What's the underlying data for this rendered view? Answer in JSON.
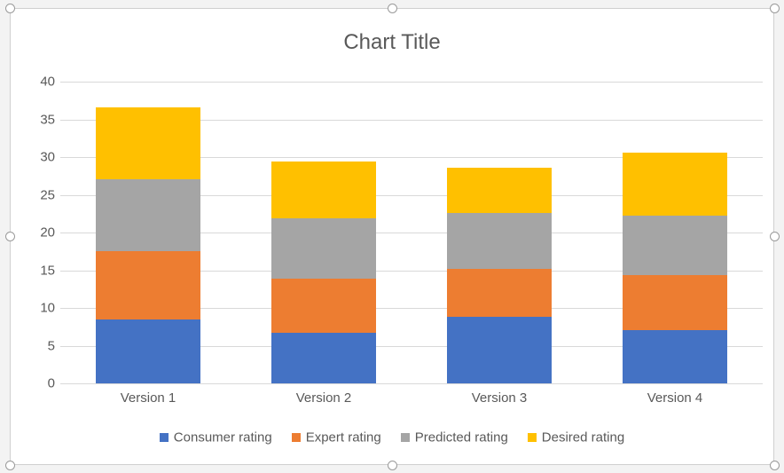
{
  "chart_data": {
    "type": "bar",
    "title": "Chart Title",
    "categories": [
      "Version 1",
      "Version 2",
      "Version 3",
      "Version 4"
    ],
    "series": [
      {
        "name": "Consumer rating",
        "color": "#4472C4",
        "values": [
          8.5,
          6.7,
          8.8,
          7.1
        ]
      },
      {
        "name": "Expert rating",
        "color": "#ED7D31",
        "values": [
          9.0,
          7.2,
          6.4,
          7.3
        ]
      },
      {
        "name": "Predicted rating",
        "color": "#A5A5A5",
        "values": [
          9.6,
          8.0,
          7.4,
          7.8
        ]
      },
      {
        "name": "Desired rating",
        "color": "#FFC000",
        "values": [
          9.5,
          7.5,
          6.0,
          8.4
        ]
      }
    ],
    "stacked": true,
    "xlabel": "",
    "ylabel": "",
    "ylim": [
      0,
      40
    ],
    "yticks": [
      0,
      5,
      10,
      15,
      20,
      25,
      30,
      35,
      40
    ]
  }
}
